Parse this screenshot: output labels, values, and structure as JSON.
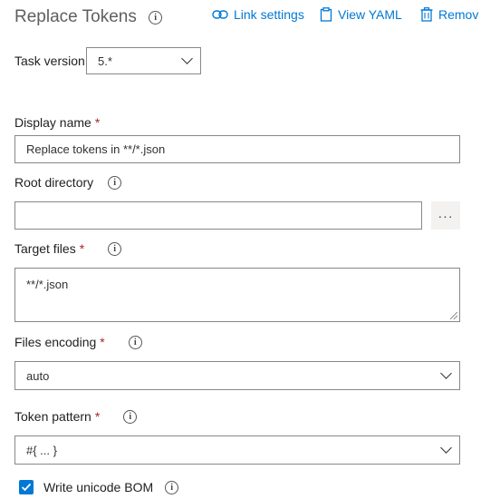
{
  "header": {
    "title": "Replace Tokens",
    "link_settings": "Link settings",
    "view_yaml": "View YAML",
    "remove": "Remov"
  },
  "task_version": {
    "label": "Task version",
    "value": "5.*"
  },
  "display_name": {
    "label": "Display name",
    "required": "*",
    "value": "Replace tokens in **/*.json"
  },
  "root_directory": {
    "label": "Root directory",
    "value": "",
    "browse_label": "···"
  },
  "target_files": {
    "label": "Target files",
    "required": "*",
    "value": "**/*.json"
  },
  "files_encoding": {
    "label": "Files encoding",
    "required": "*",
    "value": "auto"
  },
  "token_pattern": {
    "label": "Token pattern",
    "required": "*",
    "value": "#{ ... }"
  },
  "write_bom": {
    "label": "Write unicode BOM",
    "checked": true
  },
  "colors": {
    "accent": "#0078d4",
    "required": "#a4262c"
  },
  "icons": [
    "info-icon",
    "link-icon",
    "clipboard-icon",
    "trash-icon",
    "chevron-down-icon",
    "check-icon"
  ]
}
